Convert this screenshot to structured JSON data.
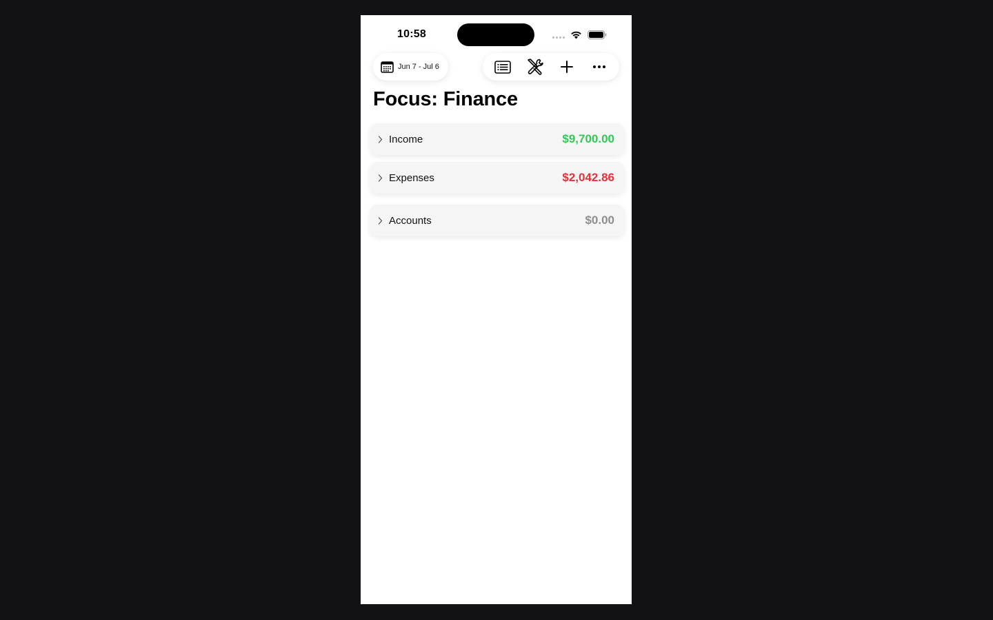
{
  "status_bar": {
    "time": "10:58"
  },
  "toolbar": {
    "date_range": "Jun 7 - Jul 6",
    "icons": [
      "calendar-icon",
      "list-icon",
      "tools-icon",
      "plus-icon",
      "more-icon"
    ]
  },
  "page": {
    "title": "Focus: Finance"
  },
  "sections": [
    {
      "name": "Income",
      "amount": "$9,700.00",
      "color": "#34c759"
    },
    {
      "name": "Expenses",
      "amount": "$2,042.86",
      "color": "#e5313b"
    },
    {
      "name": "Accounts",
      "amount": "$0.00",
      "color": "#8e8e8e"
    }
  ],
  "colors": {
    "background": "#121116",
    "income": "#34c759",
    "expenses": "#e5313b",
    "accounts": "#8e8e8e"
  }
}
